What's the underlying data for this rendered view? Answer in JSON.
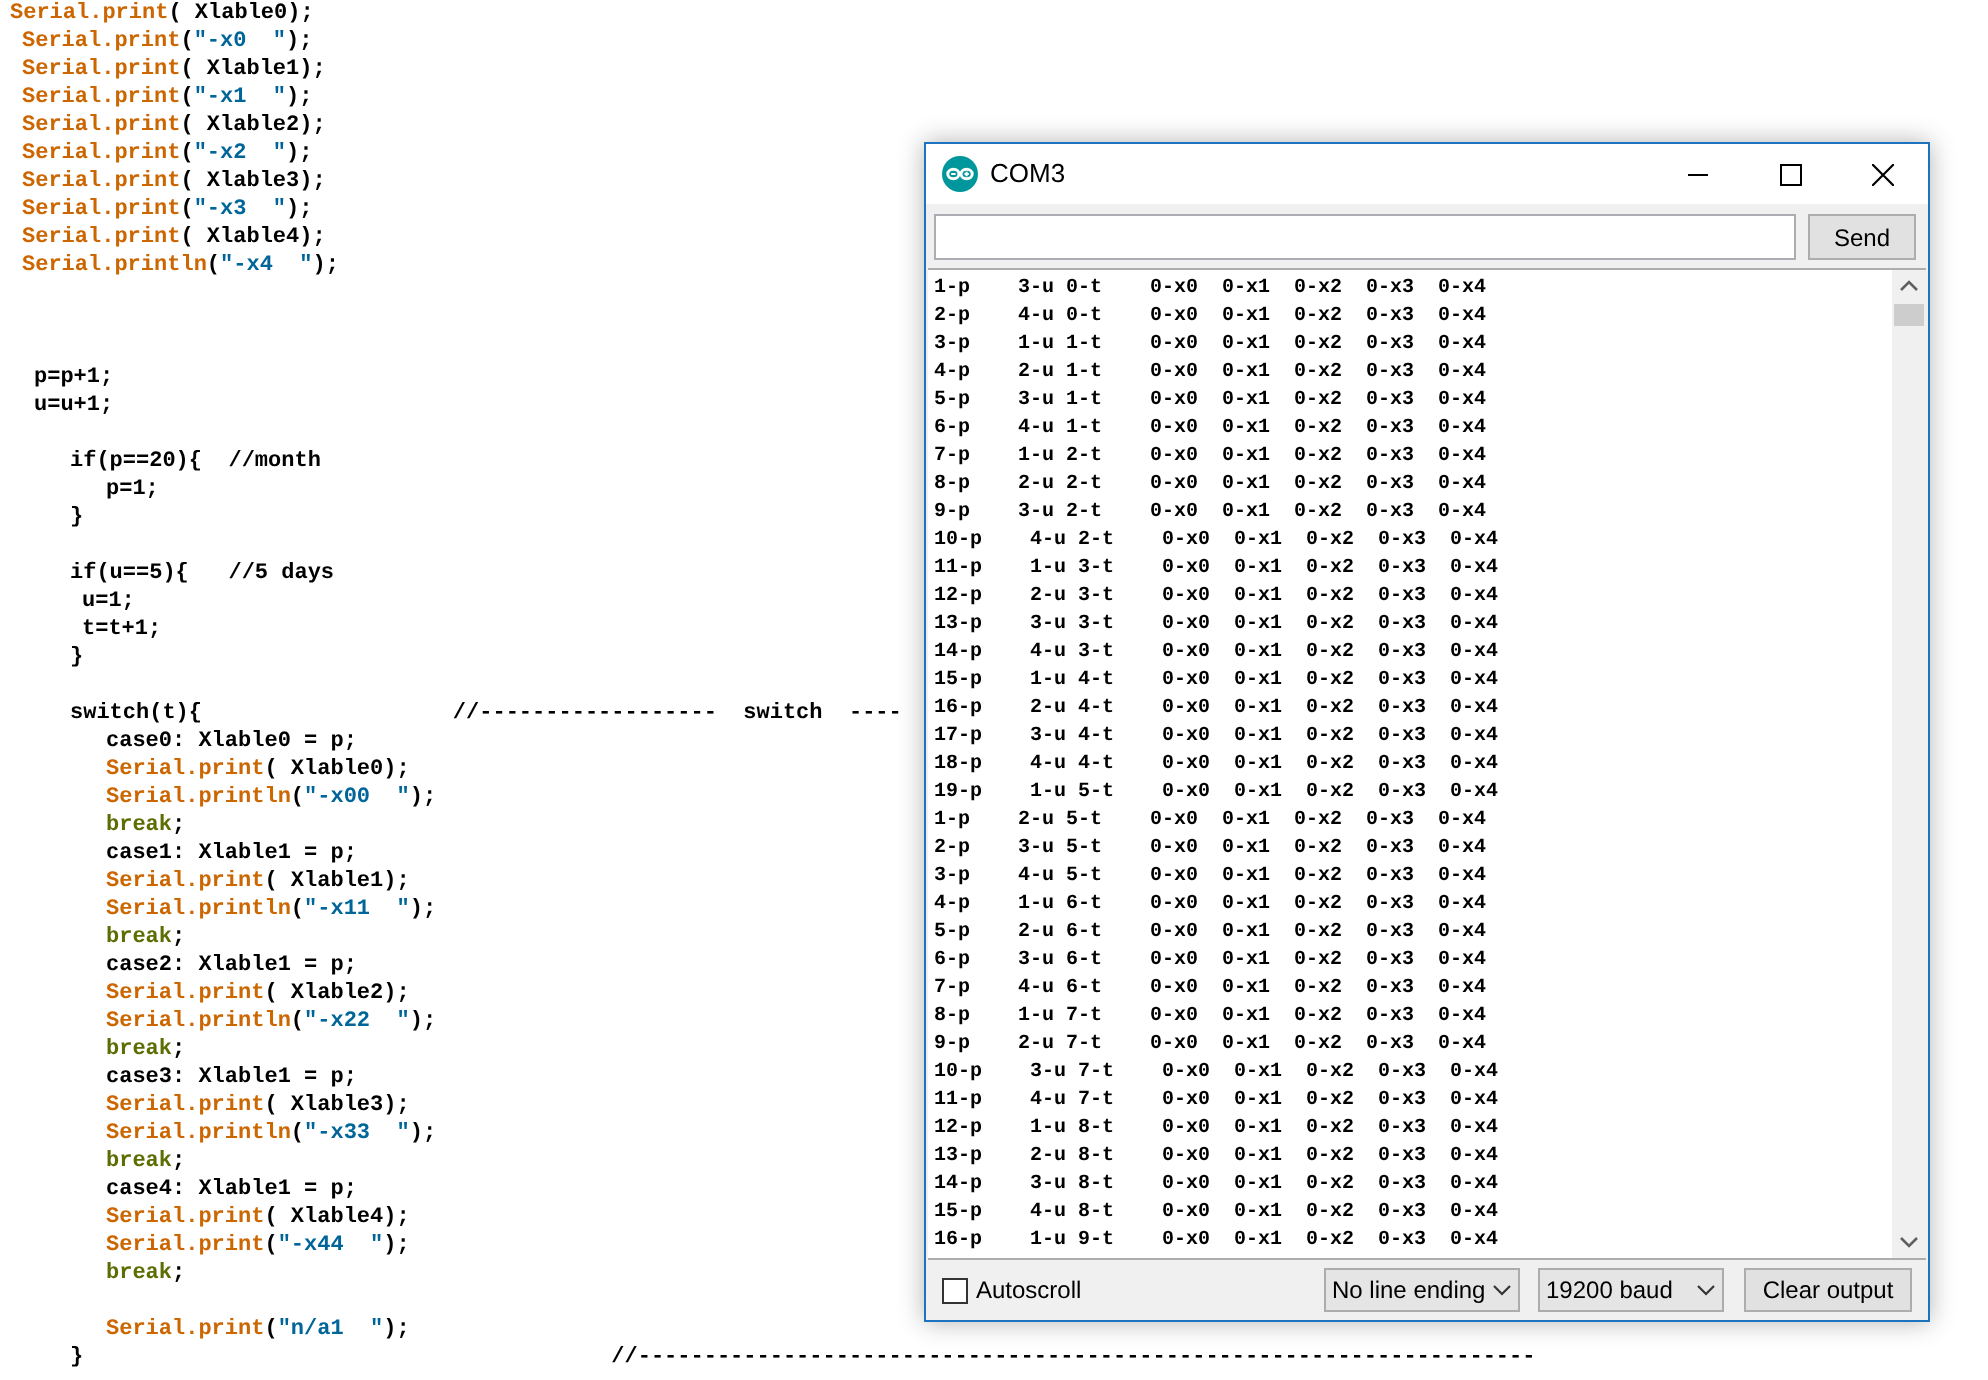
{
  "editor": {
    "blocks": [
      {
        "lines": [
          {
            "segments": [
              {
                "kind": "fn",
                "text": "Serial.print"
              },
              {
                "kind": "plain",
                "text": "( Xlable0);"
              }
            ]
          },
          {
            "segments": [
              {
                "kind": "fn",
                "text": "Serial.print"
              },
              {
                "kind": "plain",
                "text": "("
              },
              {
                "kind": "str",
                "text": "\"-x0  \""
              },
              {
                "kind": "plain",
                "text": ");"
              }
            ]
          },
          {
            "segments": [
              {
                "kind": "fn",
                "text": "Serial.print"
              },
              {
                "kind": "plain",
                "text": "( Xlable1);"
              }
            ]
          },
          {
            "segments": [
              {
                "kind": "fn",
                "text": "Serial.print"
              },
              {
                "kind": "plain",
                "text": "("
              },
              {
                "kind": "str",
                "text": "\"-x1  \""
              },
              {
                "kind": "plain",
                "text": ");"
              }
            ]
          },
          {
            "segments": [
              {
                "kind": "fn",
                "text": "Serial.print"
              },
              {
                "kind": "plain",
                "text": "( Xlable2);"
              }
            ]
          },
          {
            "segments": [
              {
                "kind": "fn",
                "text": "Serial.print"
              },
              {
                "kind": "plain",
                "text": "("
              },
              {
                "kind": "str",
                "text": "\"-x2  \""
              },
              {
                "kind": "plain",
                "text": ");"
              }
            ]
          },
          {
            "segments": [
              {
                "kind": "fn",
                "text": "Serial.print"
              },
              {
                "kind": "plain",
                "text": "( Xlable3);"
              }
            ]
          },
          {
            "segments": [
              {
                "kind": "fn",
                "text": "Serial.print"
              },
              {
                "kind": "plain",
                "text": "("
              },
              {
                "kind": "str",
                "text": "\"-x3  \""
              },
              {
                "kind": "plain",
                "text": ");"
              }
            ]
          },
          {
            "segments": [
              {
                "kind": "fn",
                "text": "Serial.print"
              },
              {
                "kind": "plain",
                "text": "( Xlable4);"
              }
            ]
          },
          {
            "segments": [
              {
                "kind": "fn",
                "text": "Serial.println"
              },
              {
                "kind": "plain",
                "text": "("
              },
              {
                "kind": "str",
                "text": "\"-x4  \""
              },
              {
                "kind": "plain",
                "text": ");"
              }
            ]
          }
        ]
      },
      {
        "lines": [
          {
            "segments": [
              {
                "kind": "plain",
                "text": "p=p+1;"
              }
            ]
          },
          {
            "segments": [
              {
                "kind": "plain",
                "text": "u=u+1;"
              }
            ]
          }
        ]
      },
      {
        "lines": [
          {
            "segments": [
              {
                "kind": "plain",
                "text": "if(p==20){  //month"
              }
            ]
          },
          {
            "segments": [
              {
                "kind": "plain",
                "text": "p=1;"
              }
            ]
          },
          {
            "segments": [
              {
                "kind": "plain",
                "text": "}"
              }
            ]
          }
        ]
      },
      {
        "lines": [
          {
            "segments": [
              {
                "kind": "plain",
                "text": "if(u==5){   //5 days"
              }
            ]
          },
          {
            "segments": [
              {
                "kind": "plain",
                "text": "u=1;"
              }
            ]
          },
          {
            "segments": [
              {
                "kind": "plain",
                "text": "t=t+1;"
              }
            ]
          },
          {
            "segments": [
              {
                "kind": "plain",
                "text": "}"
              }
            ]
          }
        ]
      },
      {
        "lines": [
          {
            "segments": [
              {
                "kind": "plain",
                "text": "switch(t){                   //------------------  switch  ----"
              }
            ]
          },
          {
            "segments": [
              {
                "kind": "plain",
                "text": "case0: Xlable0 = p;"
              }
            ]
          },
          {
            "segments": [
              {
                "kind": "fn",
                "text": "Serial.print"
              },
              {
                "kind": "plain",
                "text": "( Xlable0);"
              }
            ]
          },
          {
            "segments": [
              {
                "kind": "fn",
                "text": "Serial.println"
              },
              {
                "kind": "plain",
                "text": "("
              },
              {
                "kind": "str",
                "text": "\"-x00  \""
              },
              {
                "kind": "plain",
                "text": ");"
              }
            ]
          },
          {
            "segments": [
              {
                "kind": "kw",
                "text": "break"
              },
              {
                "kind": "plain",
                "text": ";"
              }
            ]
          },
          {
            "segments": [
              {
                "kind": "plain",
                "text": "case1: Xlable1 = p;"
              }
            ]
          },
          {
            "segments": [
              {
                "kind": "fn",
                "text": "Serial.print"
              },
              {
                "kind": "plain",
                "text": "( Xlable1);"
              }
            ]
          },
          {
            "segments": [
              {
                "kind": "fn",
                "text": "Serial.println"
              },
              {
                "kind": "plain",
                "text": "("
              },
              {
                "kind": "str",
                "text": "\"-x11  \""
              },
              {
                "kind": "plain",
                "text": ");"
              }
            ]
          },
          {
            "segments": [
              {
                "kind": "kw",
                "text": "break"
              },
              {
                "kind": "plain",
                "text": ";"
              }
            ]
          },
          {
            "segments": [
              {
                "kind": "plain",
                "text": "case2: Xlable1 = p;"
              }
            ]
          },
          {
            "segments": [
              {
                "kind": "fn",
                "text": "Serial.print"
              },
              {
                "kind": "plain",
                "text": "( Xlable2);"
              }
            ]
          },
          {
            "segments": [
              {
                "kind": "fn",
                "text": "Serial.println"
              },
              {
                "kind": "plain",
                "text": "("
              },
              {
                "kind": "str",
                "text": "\"-x22  \""
              },
              {
                "kind": "plain",
                "text": ");"
              }
            ]
          },
          {
            "segments": [
              {
                "kind": "kw",
                "text": "break"
              },
              {
                "kind": "plain",
                "text": ";"
              }
            ]
          },
          {
            "segments": [
              {
                "kind": "plain",
                "text": "case3: Xlable1 = p;"
              }
            ]
          },
          {
            "segments": [
              {
                "kind": "fn",
                "text": "Serial.print"
              },
              {
                "kind": "plain",
                "text": "( Xlable3);"
              }
            ]
          },
          {
            "segments": [
              {
                "kind": "fn",
                "text": "Serial.println"
              },
              {
                "kind": "plain",
                "text": "("
              },
              {
                "kind": "str",
                "text": "\"-x33  \""
              },
              {
                "kind": "plain",
                "text": ");"
              }
            ]
          },
          {
            "segments": [
              {
                "kind": "kw",
                "text": "break"
              },
              {
                "kind": "plain",
                "text": ";"
              }
            ]
          },
          {
            "segments": [
              {
                "kind": "plain",
                "text": "case4: Xlable1 = p;"
              }
            ]
          },
          {
            "segments": [
              {
                "kind": "fn",
                "text": "Serial.print"
              },
              {
                "kind": "plain",
                "text": "( Xlable4);"
              }
            ]
          },
          {
            "segments": [
              {
                "kind": "fn",
                "text": "Serial.print"
              },
              {
                "kind": "plain",
                "text": "("
              },
              {
                "kind": "str",
                "text": "\"-x44  \""
              },
              {
                "kind": "plain",
                "text": ");"
              }
            ]
          },
          {
            "segments": [
              {
                "kind": "kw",
                "text": "break"
              },
              {
                "kind": "plain",
                "text": ";"
              }
            ]
          }
        ]
      },
      {
        "lines": [
          {
            "segments": [
              {
                "kind": "fn",
                "text": "Serial.print"
              },
              {
                "kind": "plain",
                "text": "("
              },
              {
                "kind": "str",
                "text": "\"n/a1  \""
              },
              {
                "kind": "plain",
                "text": ");"
              }
            ]
          },
          {
            "segments": [
              {
                "kind": "plain",
                "text": "}                                        //--------------------------------------------------------------------"
              }
            ]
          }
        ]
      }
    ]
  },
  "serial_monitor": {
    "title": "COM3",
    "send_button": "Send",
    "output_lines": [
      "1-p    3-u 0-t    0-x0  0-x1  0-x2  0-x3  0-x4",
      "2-p    4-u 0-t    0-x0  0-x1  0-x2  0-x3  0-x4",
      "3-p    1-u 1-t    0-x0  0-x1  0-x2  0-x3  0-x4",
      "4-p    2-u 1-t    0-x0  0-x1  0-x2  0-x3  0-x4",
      "5-p    3-u 1-t    0-x0  0-x1  0-x2  0-x3  0-x4",
      "6-p    4-u 1-t    0-x0  0-x1  0-x2  0-x3  0-x4",
      "7-p    1-u 2-t    0-x0  0-x1  0-x2  0-x3  0-x4",
      "8-p    2-u 2-t    0-x0  0-x1  0-x2  0-x3  0-x4",
      "9-p    3-u 2-t    0-x0  0-x1  0-x2  0-x3  0-x4",
      "10-p    4-u 2-t    0-x0  0-x1  0-x2  0-x3  0-x4",
      "11-p    1-u 3-t    0-x0  0-x1  0-x2  0-x3  0-x4",
      "12-p    2-u 3-t    0-x0  0-x1  0-x2  0-x3  0-x4",
      "13-p    3-u 3-t    0-x0  0-x1  0-x2  0-x3  0-x4",
      "14-p    4-u 3-t    0-x0  0-x1  0-x2  0-x3  0-x4",
      "15-p    1-u 4-t    0-x0  0-x1  0-x2  0-x3  0-x4",
      "16-p    2-u 4-t    0-x0  0-x1  0-x2  0-x3  0-x4",
      "17-p    3-u 4-t    0-x0  0-x1  0-x2  0-x3  0-x4",
      "18-p    4-u 4-t    0-x0  0-x1  0-x2  0-x3  0-x4",
      "19-p    1-u 5-t    0-x0  0-x1  0-x2  0-x3  0-x4",
      "1-p    2-u 5-t    0-x0  0-x1  0-x2  0-x3  0-x4",
      "2-p    3-u 5-t    0-x0  0-x1  0-x2  0-x3  0-x4",
      "3-p    4-u 5-t    0-x0  0-x1  0-x2  0-x3  0-x4",
      "4-p    1-u 6-t    0-x0  0-x1  0-x2  0-x3  0-x4",
      "5-p    2-u 6-t    0-x0  0-x1  0-x2  0-x3  0-x4",
      "6-p    3-u 6-t    0-x0  0-x1  0-x2  0-x3  0-x4",
      "7-p    4-u 6-t    0-x0  0-x1  0-x2  0-x3  0-x4",
      "8-p    1-u 7-t    0-x0  0-x1  0-x2  0-x3  0-x4",
      "9-p    2-u 7-t    0-x0  0-x1  0-x2  0-x3  0-x4",
      "10-p    3-u 7-t    0-x0  0-x1  0-x2  0-x3  0-x4",
      "11-p    4-u 7-t    0-x0  0-x1  0-x2  0-x3  0-x4",
      "12-p    1-u 8-t    0-x0  0-x1  0-x2  0-x3  0-x4",
      "13-p    2-u 8-t    0-x0  0-x1  0-x2  0-x3  0-x4",
      "14-p    3-u 8-t    0-x0  0-x1  0-x2  0-x3  0-x4",
      "15-p    4-u 8-t    0-x0  0-x1  0-x2  0-x3  0-x4",
      "16-p    1-u 9-t    0-x0  0-x1  0-x2  0-x3  0-x4"
    ],
    "autoscroll": {
      "label": "Autoscroll",
      "checked": false
    },
    "line_ending": "No line ending",
    "baud_rate": "19200 baud",
    "clear_button": "Clear output"
  }
}
